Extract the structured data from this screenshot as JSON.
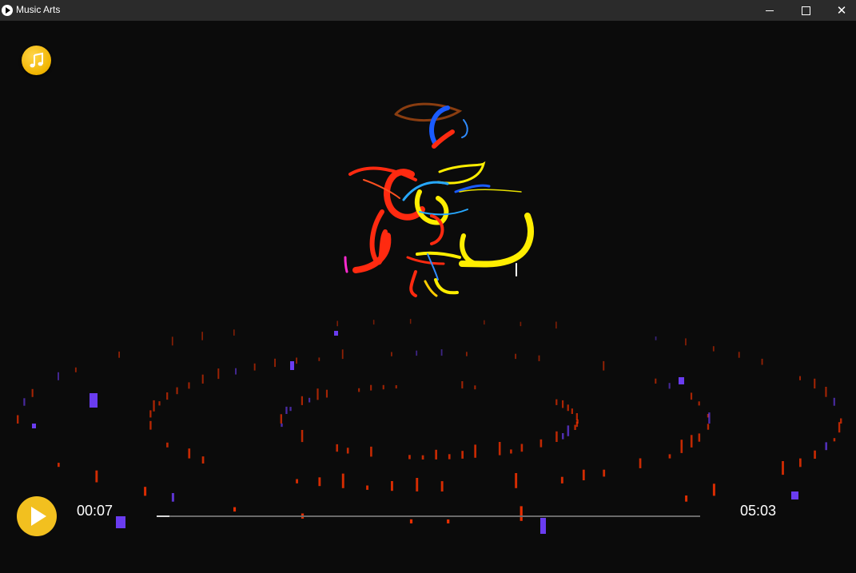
{
  "window": {
    "title": "Music Arts",
    "controls": {
      "minimize": "minimize",
      "maximize": "maximize",
      "close": "✕"
    }
  },
  "toolbar": {
    "music_icon": "music-note-icon"
  },
  "player": {
    "current_time": "00:07",
    "total_time": "05:03",
    "progress_fraction": 0.023,
    "play_icon": "play-icon"
  },
  "colors": {
    "accent": "#f2c01f",
    "background": "#0b0b0b",
    "titlebar": "#2b2b2b",
    "stroke_red": "#ff2a10",
    "stroke_yellow": "#ffee00",
    "stroke_blue": "#1a5bff",
    "stroke_brown": "#8a3d10",
    "bar_red": "#ff3300",
    "bar_purple": "#6a3cf0"
  }
}
